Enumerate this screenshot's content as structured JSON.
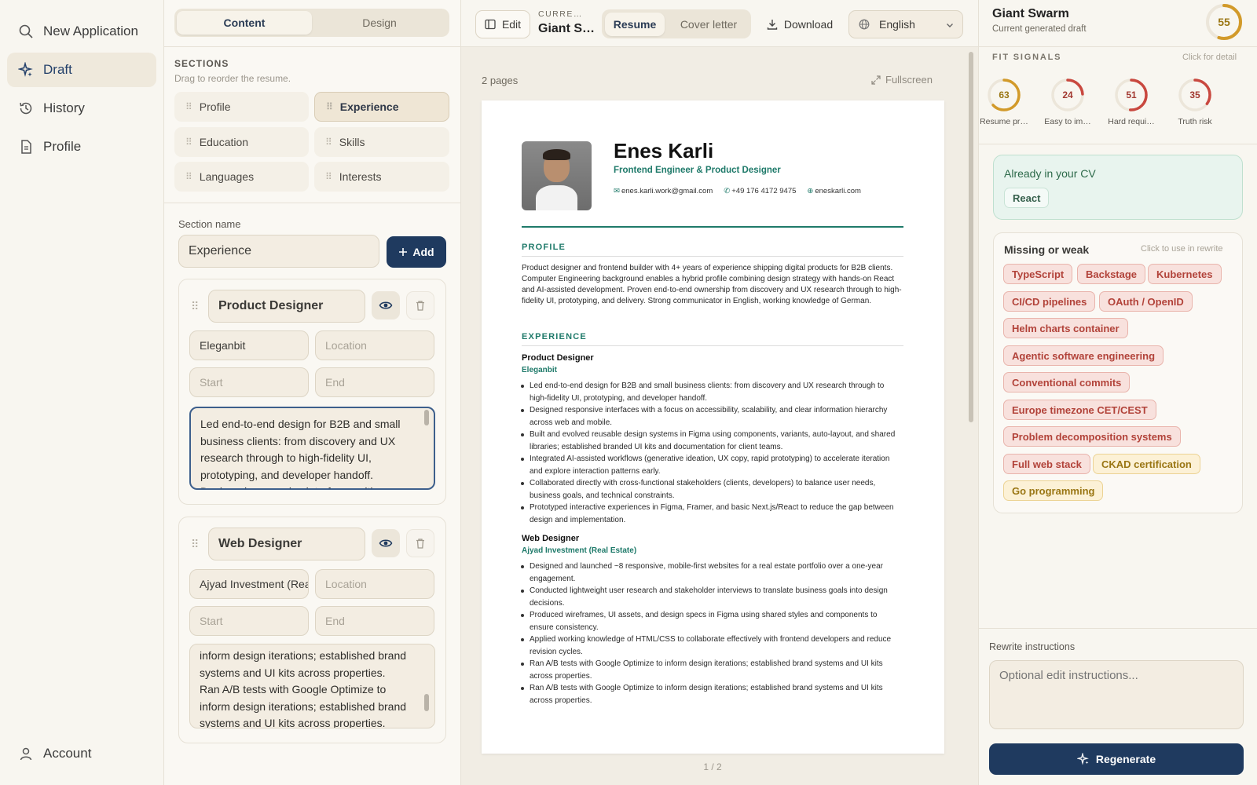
{
  "sidebar": {
    "items": [
      {
        "label": "New Application",
        "icon": "search-icon"
      },
      {
        "label": "Draft",
        "icon": "sparkle-icon"
      },
      {
        "label": "History",
        "icon": "history-icon"
      },
      {
        "label": "Profile",
        "icon": "document-icon"
      }
    ],
    "account": "Account"
  },
  "editor": {
    "tabs": [
      "Content",
      "Design"
    ],
    "sections_title": "SECTIONS",
    "sections_hint": "Drag to reorder the resume.",
    "sections": [
      "Profile",
      "Experience",
      "Education",
      "Skills",
      "Languages",
      "Interests"
    ],
    "section_name_label": "Section name",
    "section_name_value": "Experience",
    "add_label": "Add",
    "entries": [
      {
        "title": "Product Designer",
        "company": "Eleganbit",
        "location_placeholder": "Location",
        "start_placeholder": "Start",
        "end_placeholder": "End",
        "description": "Led end-to-end design for B2B and small business clients: from discovery and UX research through to high-fidelity UI, prototyping, and developer handoff.\nDesigned responsive interfaces with a"
      },
      {
        "title": "Web Designer",
        "company": "Ajyad Investment (Real Estate)",
        "location_placeholder": "Location",
        "start_placeholder": "Start",
        "end_placeholder": "End",
        "description": "inform design iterations; established brand systems and UI kits across properties.\nRan A/B tests with Google Optimize to inform design iterations; established brand systems and UI kits across properties."
      }
    ]
  },
  "toolbar": {
    "edit": "Edit",
    "current_label": "CURRE…",
    "current_value": "Giant S…",
    "doc_tabs": [
      "Resume",
      "Cover letter"
    ],
    "download": "Download",
    "language": "English"
  },
  "preview": {
    "pages": "2 pages",
    "fullscreen": "Fullscreen",
    "pager": "1 / 2"
  },
  "resume": {
    "name": "Enes Karli",
    "title": "Frontend Engineer & Product Designer",
    "email": "enes.karli.work@gmail.com",
    "phone": "+49 176 4172 9475",
    "site": "eneskarli.com",
    "profile_head": "PROFILE",
    "profile_text": "Product designer and frontend builder with 4+ years of experience shipping digital products for B2B clients. Computer Engineering background enables a hybrid profile combining design strategy with hands-on React and AI-assisted development. Proven end-to-end ownership from discovery and UX research through to high-fidelity UI, prototyping, and delivery. Strong communicator in English, working knowledge of German.",
    "experience_head": "EXPERIENCE",
    "jobs": [
      {
        "role": "Product Designer",
        "company": "Eleganbit",
        "bullets": [
          "Led end-to-end design for B2B and small business clients: from discovery and UX research through to high-fidelity UI, prototyping, and developer handoff.",
          "Designed responsive interfaces with a focus on accessibility, scalability, and clear information hierarchy across web and mobile.",
          "Built and evolved reusable design systems in Figma using components, variants, auto-layout, and shared libraries; established branded UI kits and documentation for client teams.",
          "Integrated AI-assisted workflows (generative ideation, UX copy, rapid prototyping) to accelerate iteration and explore interaction patterns early.",
          "Collaborated directly with cross-functional stakeholders (clients, developers) to balance user needs, business goals, and technical constraints.",
          "Prototyped interactive experiences in Figma, Framer, and basic Next.js/React to reduce the gap between design and implementation."
        ]
      },
      {
        "role": "Web Designer",
        "company": "Ajyad Investment (Real Estate)",
        "bullets": [
          "Designed and launched ~8 responsive, mobile-first websites for a real estate portfolio over a one-year engagement.",
          "Conducted lightweight user research and stakeholder interviews to translate business goals into design decisions.",
          "Produced wireframes, UI assets, and design specs in Figma using shared styles and components to ensure consistency.",
          "Applied working knowledge of HTML/CSS to collaborate effectively with frontend developers and reduce revision cycles.",
          "Ran A/B tests with Google Optimize to inform design iterations; established brand systems and UI kits across properties.",
          "Ran A/B tests with Google Optimize to inform design iterations; established brand systems and UI kits across properties."
        ]
      }
    ]
  },
  "panel": {
    "company": "Giant Swarm",
    "subtitle": "Current generated draft",
    "score": 55,
    "fit_title": "FIT SIGNALS",
    "fit_hint": "Click for detail",
    "signals": [
      {
        "label": "Resume pr…",
        "value": 63,
        "color": "#d29a2a"
      },
      {
        "label": "Easy to im…",
        "value": 24,
        "color": "#c9483f"
      },
      {
        "label": "Hard requi…",
        "value": 51,
        "color": "#c9483f"
      },
      {
        "label": "Truth risk",
        "value": 35,
        "color": "#c9483f"
      }
    ],
    "already_title": "Already in your CV",
    "already": [
      "React"
    ],
    "missing_title": "Missing or weak",
    "missing_hint": "Click to use in rewrite",
    "missing_red": [
      "TypeScript",
      "Backstage",
      "Kubernetes",
      "CI/CD pipelines",
      "OAuth / OpenID",
      "Helm charts container",
      "Agentic software engineering",
      "Conventional commits",
      "Europe timezone CET/CEST",
      "Problem decomposition systems",
      "Full web stack"
    ],
    "missing_yellow": [
      "CKAD certification",
      "Go programming"
    ],
    "rewrite_label": "Rewrite instructions",
    "rewrite_placeholder": "Optional edit instructions...",
    "regenerate": "Regenerate"
  },
  "colors": {
    "navy": "#1f3a5f",
    "teal": "#1f7a6a",
    "gold": "#d29a2a",
    "red": "#c9483f"
  }
}
